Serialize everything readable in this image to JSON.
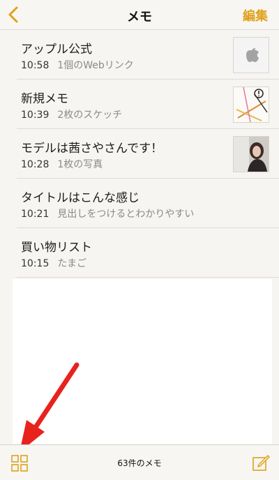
{
  "colors": {
    "accent": "#e0a21a",
    "annotation_arrow": "#e8231c"
  },
  "navbar": {
    "back_icon": "chevron-left-icon",
    "title": "メモ",
    "edit_label": "編集"
  },
  "notes": [
    {
      "title": "アップル公式",
      "time": "10:58",
      "preview": "1個のWebリンク",
      "thumbnail": "apple-logo"
    },
    {
      "title": "新規メモ",
      "time": "10:39",
      "preview": "2枚のスケッチ",
      "thumbnail": "sketch"
    },
    {
      "title": "モデルは茜さやさんです！",
      "time": "10:28",
      "preview": "1枚の写真",
      "thumbnail": "photo"
    },
    {
      "title": "タイトルはこんな感じ",
      "time": "10:21",
      "preview": "見出しをつけるとわかりやすい"
    },
    {
      "title": "買い物リスト",
      "time": "10:15",
      "preview": "たまご"
    }
  ],
  "toolbar": {
    "grid_icon": "grid-view-icon",
    "count_label": "63件のメモ",
    "compose_icon": "compose-icon"
  }
}
